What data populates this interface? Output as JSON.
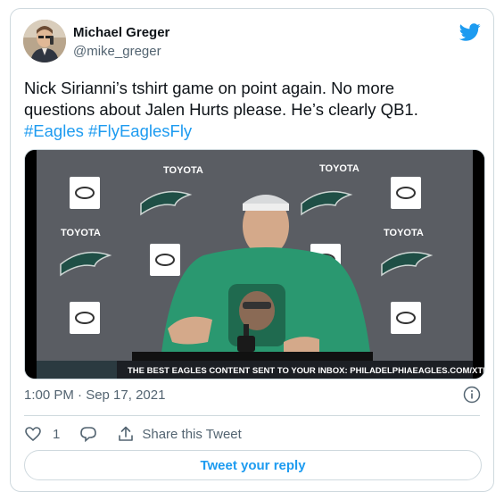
{
  "author": {
    "display_name": "Michael Greger",
    "handle": "@mike_greger"
  },
  "tweet": {
    "text_line1": "Nick Sirianni’s tshirt game on point again. No more",
    "text_line2": "questions about Jalen Hurts please. He’s clearly QB1.",
    "hashtag1": "#Eagles",
    "hashtag2": "#FlyEaglesFly"
  },
  "media": {
    "sponsor_text": "TOYOTA",
    "ticker_text": "THE BEST EAGLES CONTENT SENT TO YOUR INBOX: PHILADELPHIAEAGLES.COM/XTRA"
  },
  "meta": {
    "timestamp": "1:00 PM · Sep 17, 2021"
  },
  "actions": {
    "like_count": "1",
    "share_label": "Share this Tweet",
    "reply_button_label": "Tweet your reply"
  },
  "icons": {
    "brand": "twitter-bird-icon",
    "heart": "heart-icon",
    "reply": "reply-bubble-icon",
    "share": "share-upload-icon",
    "info": "info-icon"
  },
  "colors": {
    "accent": "#1d9bf0",
    "text": "#0f1419",
    "muted": "#536471",
    "border": "#cfd9de"
  }
}
